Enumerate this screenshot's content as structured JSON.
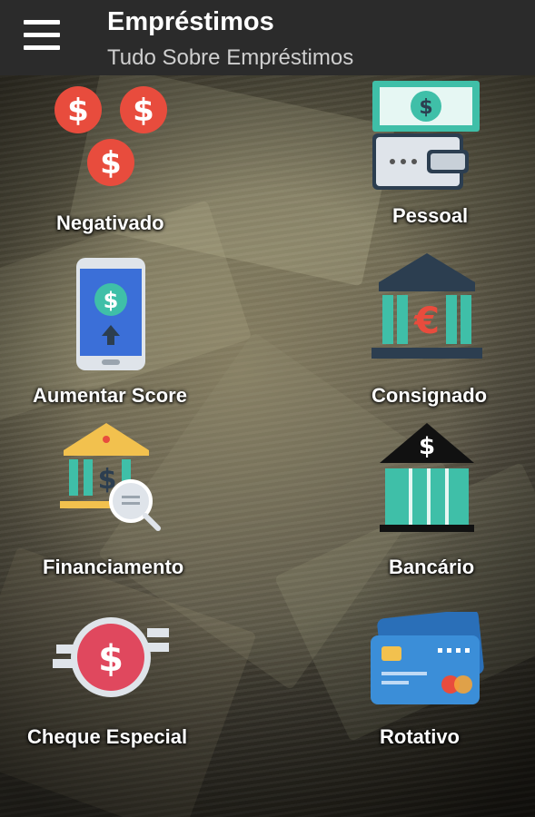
{
  "appbar": {
    "title": "Empréstimos",
    "subtitle": "Tudo Sobre Empréstimos",
    "menu_icon": "hamburger-menu-icon"
  },
  "menu": [
    {
      "label": "Negativado",
      "icon": "dollar-coins-icon"
    },
    {
      "label": "Pessoal",
      "icon": "wallet-banknote-icon"
    },
    {
      "label": "Aumentar Score",
      "icon": "smartphone-dollar-icon"
    },
    {
      "label": "Consignado",
      "icon": "bank-euro-icon"
    },
    {
      "label": "Financiamento",
      "icon": "bank-magnifier-icon"
    },
    {
      "label": "Bancário",
      "icon": "bank-dollar-icon"
    },
    {
      "label": "Cheque Especial",
      "icon": "dollar-badge-icon"
    },
    {
      "label": "Rotativo",
      "icon": "credit-card-icon"
    }
  ],
  "colors": {
    "appbar": "#2b2b2b",
    "coin_red": "#e84c3d",
    "teal": "#3fbfa8",
    "navy": "#2c3e50",
    "card_blue": "#3b8ed8",
    "gold": "#f2c14e"
  }
}
